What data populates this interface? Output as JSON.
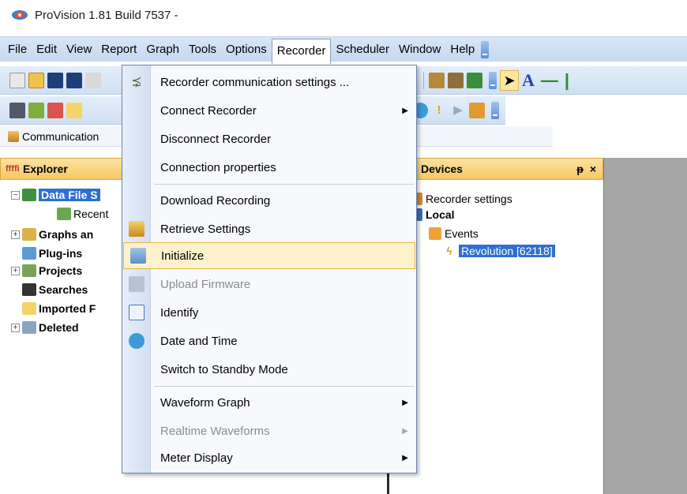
{
  "window": {
    "title": "ProVision 1.81 Build 7537 -"
  },
  "menubar": {
    "items": [
      {
        "label": "File"
      },
      {
        "label": "Edit"
      },
      {
        "label": "View"
      },
      {
        "label": "Report"
      },
      {
        "label": "Graph"
      },
      {
        "label": "Tools"
      },
      {
        "label": "Options"
      },
      {
        "label": "Recorder",
        "active": true
      },
      {
        "label": "Scheduler"
      },
      {
        "label": "Window"
      },
      {
        "label": "Help"
      }
    ]
  },
  "tabstrip": {
    "label": "Communication"
  },
  "explorer": {
    "title": "Explorer",
    "items": [
      {
        "label": "Data File S",
        "selected": true,
        "expander": "−"
      },
      {
        "label": "Recent",
        "bold": false
      },
      {
        "label": "Graphs an",
        "expander": "+"
      },
      {
        "label": "Plug-ins"
      },
      {
        "label": "Projects",
        "expander": "+"
      },
      {
        "label": "Searches"
      },
      {
        "label": "Imported F"
      },
      {
        "label": "Deleted",
        "expander": "+"
      }
    ]
  },
  "devices": {
    "title": "Devices",
    "pin": "ᵽ",
    "close": "×",
    "items": [
      {
        "label": "Recorder settings"
      },
      {
        "label": "Local"
      },
      {
        "label": "Events"
      },
      {
        "label": "Revolution [62118]"
      }
    ]
  },
  "dropdown": {
    "items": [
      {
        "label": "Recorder communication settings ...",
        "icon": "satellite-icon"
      },
      {
        "label": "Connect Recorder",
        "submenu": true
      },
      {
        "label": "Disconnect Recorder"
      },
      {
        "label": "Connection properties"
      },
      {
        "label": "Download Recording"
      },
      {
        "label": "Retrieve Settings",
        "icon": "retrieve-icon"
      },
      {
        "label": "Initialize",
        "icon": "initialize-icon",
        "highlight": true
      },
      {
        "label": "Upload Firmware",
        "icon": "upload-icon",
        "disabled": true
      },
      {
        "label": "Identify",
        "icon": "identify-icon"
      },
      {
        "label": "Date and Time",
        "icon": "clock-icon"
      },
      {
        "label": "Switch to Standby Mode"
      },
      {
        "label": "Waveform Graph",
        "submenu": true
      },
      {
        "label": "Realtime Waveforms",
        "submenu": true,
        "disabled": true
      },
      {
        "label": "Meter Display",
        "submenu": true
      }
    ],
    "submenu_arrow": "▶"
  }
}
